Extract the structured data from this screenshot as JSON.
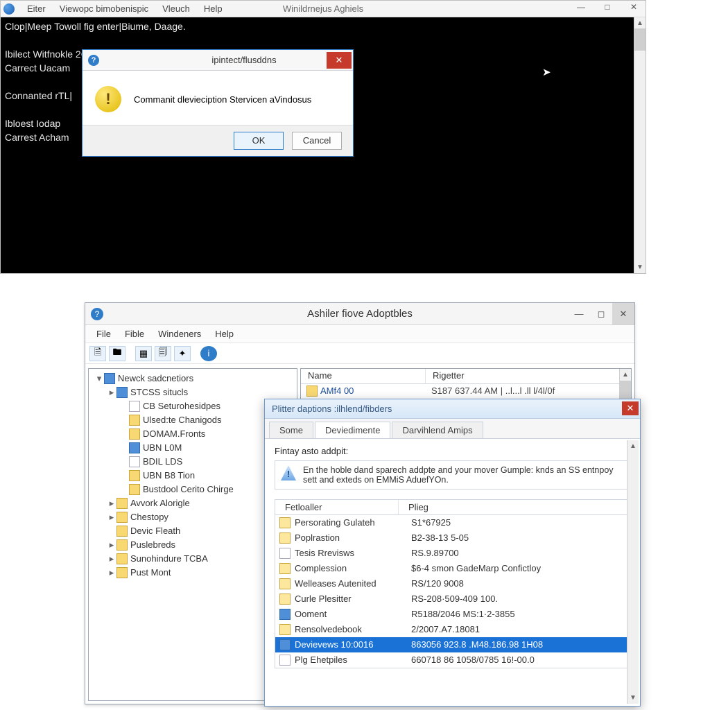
{
  "console": {
    "menu": [
      "Eiter",
      "Viewopc bimobenispic",
      "Vleuch",
      "Help"
    ],
    "title": "Winildrnejus Aghiels",
    "lines": [
      "Clop|Meep Towoll fig enter|Biume, Daage.",
      "",
      "Ibilect Witfnokle 2ONS Plarsi..",
      "Carrect Uacam",
      "",
      "Connanted rTL|                                      py orfilee_Teel that iemole pea..",
      "",
      "Ibloest Iodap",
      "Carrest Acham"
    ]
  },
  "dialog": {
    "title": "ipintect/flusddns",
    "message": "Commanit dlevieciption Stervicen aVindosus",
    "ok": "OK",
    "cancel": "Cancel"
  },
  "explorer": {
    "title": "Ashiler fiove Adoptbles",
    "menu": [
      "File",
      "Fible",
      "Windeners",
      "Help"
    ],
    "tree": [
      {
        "l": 1,
        "exp": "▾",
        "icon": "blue",
        "label": "Newck sadcnetiors"
      },
      {
        "l": 2,
        "exp": "▸",
        "icon": "blue",
        "label": "STCSS situcls"
      },
      {
        "l": 3,
        "exp": "",
        "icon": "doc",
        "label": "CB Seturohesidpes"
      },
      {
        "l": 3,
        "exp": "",
        "icon": "folder",
        "label": "Ulsed:te Chanigods"
      },
      {
        "l": 3,
        "exp": "",
        "icon": "folder",
        "label": "DOMAM.Fronts"
      },
      {
        "l": 3,
        "exp": "",
        "icon": "blue",
        "label": "UBN L0M"
      },
      {
        "l": 3,
        "exp": "",
        "icon": "doc",
        "label": "BDIL LDS"
      },
      {
        "l": 3,
        "exp": "",
        "icon": "folder",
        "label": "UBN B8 Tion"
      },
      {
        "l": 3,
        "exp": "",
        "icon": "folder",
        "label": "Bustdool Cerito Chirge"
      },
      {
        "l": 2,
        "exp": "▸",
        "icon": "folder",
        "label": "Avvork Alorigle"
      },
      {
        "l": 2,
        "exp": "▸",
        "icon": "folder",
        "label": "Chestopy"
      },
      {
        "l": 2,
        "exp": "",
        "icon": "folder",
        "label": "Devic Fleath"
      },
      {
        "l": 2,
        "exp": "▸",
        "icon": "folder",
        "label": "Puslebreds"
      },
      {
        "l": 2,
        "exp": "▸",
        "icon": "folder",
        "label": "Sunohindure TCBA"
      },
      {
        "l": 2,
        "exp": "▸",
        "icon": "folder",
        "label": "Pust Mont"
      }
    ],
    "list": {
      "cols": [
        "Name",
        "Rigetter"
      ],
      "row_name": "AMf4 00",
      "row_val": "S187 637.44 AM | ..l...l .ll l/4l/0f"
    }
  },
  "props": {
    "title": "Plitter daptions :ilhlend/fibders",
    "tabs": [
      "Some",
      "Deviedimente",
      "Darvihlend Amips"
    ],
    "active_tab_index": 1,
    "heading": "Fintay asto addpit:",
    "note": "En the hoble dand sparech addpte and your mover Gumple: knds an SS entnpoy sett and exteds on EMMiS AduefYOn.",
    "cols": [
      "Fetloaller",
      "Plieg"
    ],
    "rows": [
      {
        "icon": "y",
        "name": "Persorating Gulateh",
        "val": "S1*67925"
      },
      {
        "icon": "y",
        "name": "Poplrastion",
        "val": "B2-38-13 5-05"
      },
      {
        "icon": "g",
        "name": "Tesis Rrevisws",
        "val": "RS.9.89700"
      },
      {
        "icon": "y",
        "name": "Complession",
        "val": "$6-4 smon GadeMarp Confictloy"
      },
      {
        "icon": "y",
        "name": "Welleases Autenited",
        "val": "RS/120 9008"
      },
      {
        "icon": "y",
        "name": "Curle Plesitter",
        "val": "RS-208·509-409 100."
      },
      {
        "icon": "b",
        "name": "Ooment",
        "val": "R5188/2046 MS:1·2-3855"
      },
      {
        "icon": "y",
        "name": "Rensolvedebook",
        "val": "2/2007.A7.18081"
      },
      {
        "icon": "b",
        "name": "Devievews 10:0016",
        "val": "863056 923.8 .M48.186.98 1H08",
        "selected": true
      },
      {
        "icon": "g",
        "name": "Plg Ehetpiles",
        "val": "660718 86 1058/0785 16!-00.0"
      }
    ]
  }
}
